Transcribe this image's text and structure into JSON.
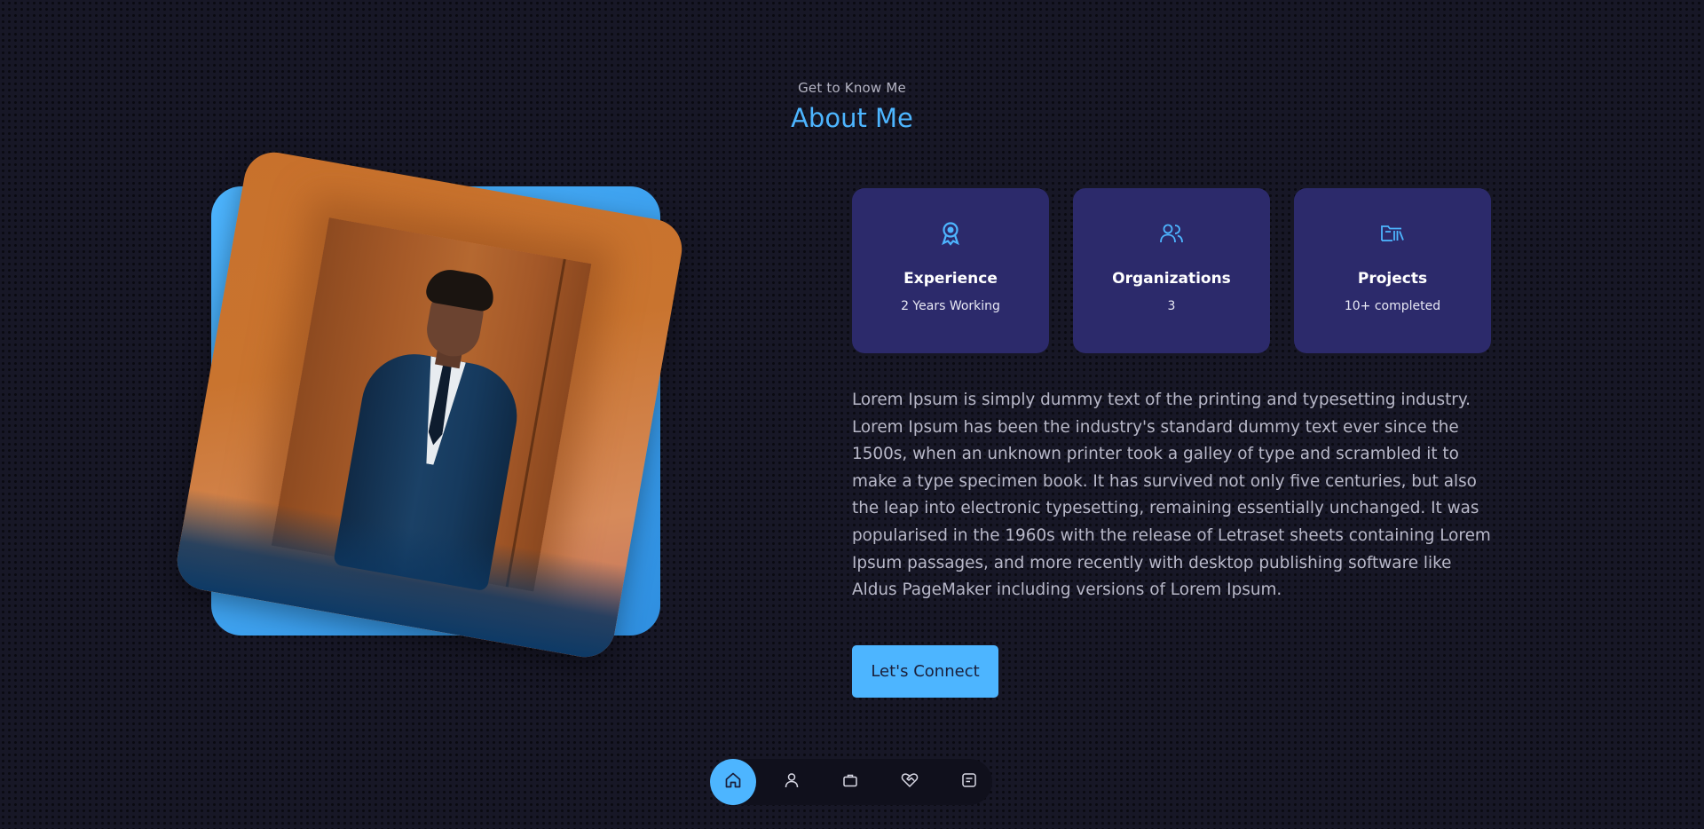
{
  "header": {
    "subtitle": "Get to Know Me",
    "title": "About Me"
  },
  "cards": [
    {
      "icon": "award-icon",
      "label": "Experience",
      "value": "2 Years Working"
    },
    {
      "icon": "users-icon",
      "label": "Organizations",
      "value": "3"
    },
    {
      "icon": "folder-icon",
      "label": "Projects",
      "value": "10+ completed"
    }
  ],
  "description": "Lorem Ipsum is simply dummy text of the printing and typesetting industry. Lorem Ipsum has been the industry's standard dummy text ever since the 1500s, when an unknown printer took a galley of type and scrambled it to make a type specimen book. It has survived not only five centuries, but also the leap into electronic typesetting, remaining essentially unchanged. It was popularised in the 1960s with the release of Letraset sheets containing Lorem Ipsum passages, and more recently with desktop publishing software like Aldus PageMaker including versions of Lorem Ipsum.",
  "cta": {
    "label": "Let's Connect"
  },
  "nav": {
    "items": [
      {
        "icon": "home-icon",
        "active": true
      },
      {
        "icon": "user-icon",
        "active": false
      },
      {
        "icon": "briefcase-icon",
        "active": false
      },
      {
        "icon": "handshake-icon",
        "active": false
      },
      {
        "icon": "message-icon",
        "active": false
      }
    ]
  },
  "colors": {
    "background": "#171726",
    "accent": "#4db5ff",
    "card": "#2c2a6b",
    "nav_bg": "#10101c"
  }
}
